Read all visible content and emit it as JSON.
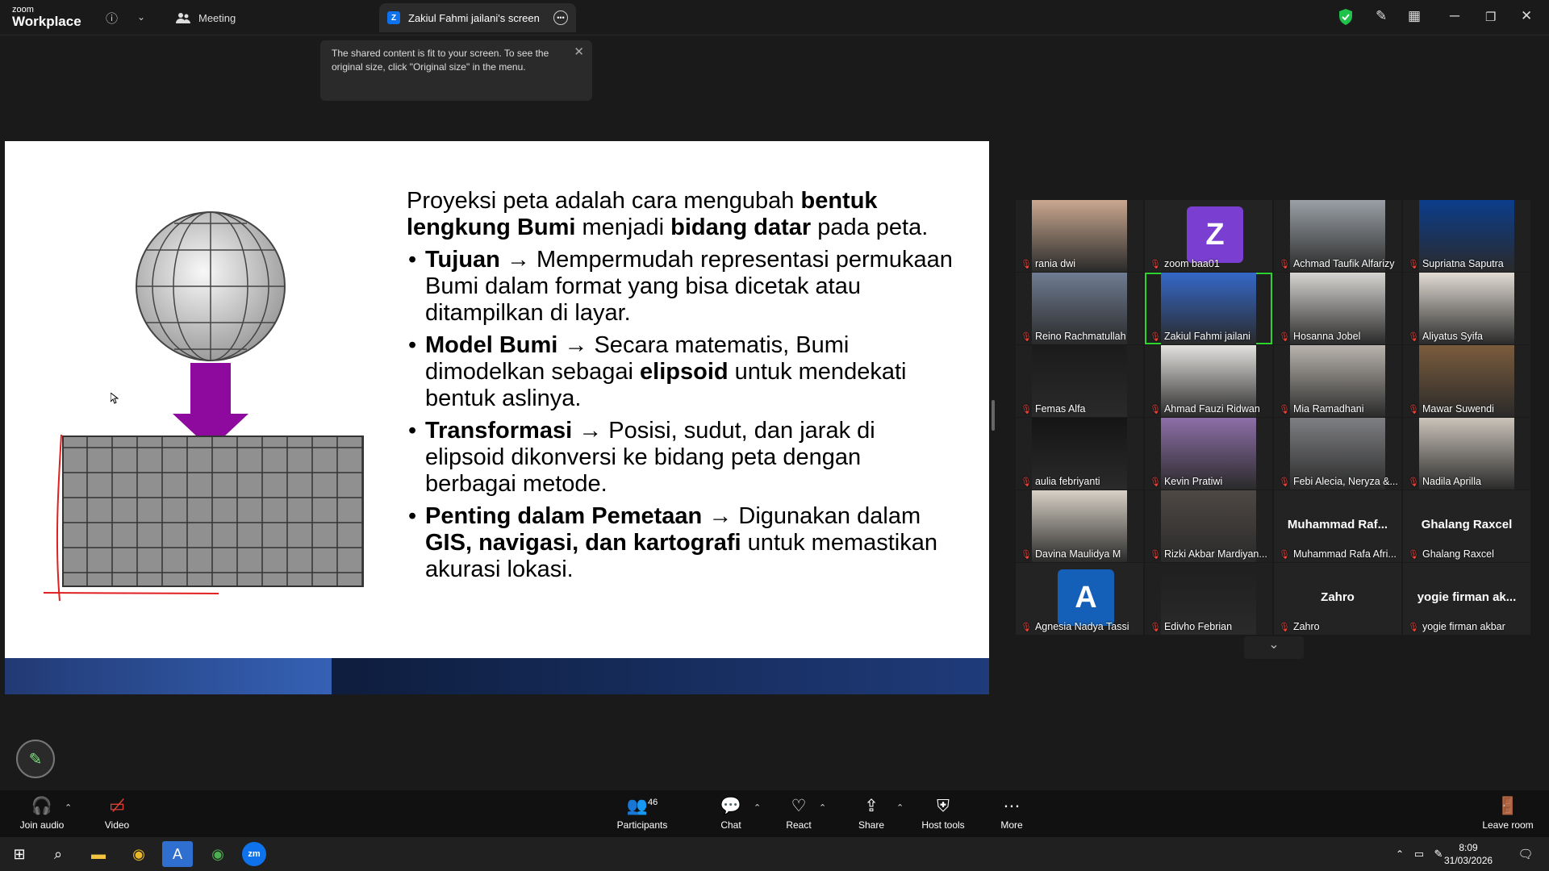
{
  "app": {
    "logo_small": "zoom",
    "logo_big": "Workplace",
    "meeting_label": "Meeting",
    "share_tab": "Zakiul Fahmi jailani's screen",
    "tab_icon_letter": "Z"
  },
  "tooltip": {
    "text": "The shared content is fit to your screen. To see the original size, click \"Original size\" in the menu."
  },
  "slide": {
    "intro": {
      "a": "Proyeksi peta adalah cara mengubah ",
      "b": "bentuk lengkung Bumi",
      "c": " menjadi ",
      "d": "bidang datar",
      "e": " pada peta."
    },
    "bullets": [
      {
        "head": "Tujuan",
        "arrow": " → ",
        "body": "Mempermudah representasi permukaan Bumi dalam format yang bisa dicetak atau ditampilkan di layar.",
        "bold2": "",
        "tail": ""
      },
      {
        "head": "Model Bumi",
        "arrow": " → ",
        "body": "Secara matematis, Bumi dimodelkan sebagai ",
        "bold2": "elipsoid",
        "tail": " untuk mendekati bentuk aslinya."
      },
      {
        "head": "Transformasi",
        "arrow": " → ",
        "body": "Posisi, sudut, dan jarak di elipsoid dikonversi ke bidang peta dengan berbagai metode.",
        "bold2": "",
        "tail": ""
      },
      {
        "head": "Penting dalam Pemetaan",
        "arrow": " → ",
        "body": "Digunakan dalam ",
        "bold2": "GIS, navigasi, dan kartografi",
        "tail": " untuk memastikan akurasi lokasi."
      }
    ]
  },
  "participants_grid": [
    {
      "name": "rania dwi",
      "type": "video",
      "bg": "#caa890"
    },
    {
      "name": "zoom baa01",
      "type": "avatar",
      "letter": "Z",
      "color": "#7a3fd0"
    },
    {
      "name": "Achmad Taufik Alfarizy",
      "type": "video",
      "bg": "#9aa0a6"
    },
    {
      "name": "Supriatna Saputra",
      "type": "video",
      "bg": "#0b3d8c"
    },
    {
      "name": "Reino Rachmatullah",
      "type": "video",
      "bg": "#6f7c92"
    },
    {
      "name": "Zakiul Fahmi jailani",
      "type": "video",
      "bg": "#3568c8",
      "active": true
    },
    {
      "name": "Hosanna Jobel",
      "type": "video",
      "bg": "#d7d5d2"
    },
    {
      "name": "Aliyatus Syifa",
      "type": "video",
      "bg": "#e2dcd4"
    },
    {
      "name": "Femas Alfa",
      "type": "video",
      "bg": "#1b1b1b"
    },
    {
      "name": "Ahmad Fauzi Ridwan",
      "type": "video",
      "bg": "#e4e2df"
    },
    {
      "name": "Mia Ramadhani",
      "type": "video",
      "bg": "#b9b4ad"
    },
    {
      "name": "Mawar Suwendi",
      "type": "video",
      "bg": "#7b5c3c"
    },
    {
      "name": "aulia febriyanti",
      "type": "video",
      "bg": "#151515"
    },
    {
      "name": "Kevin Pratiwi",
      "type": "video",
      "bg": "#8d6fa8"
    },
    {
      "name": "Febi Alecia, Neryza &...",
      "type": "video",
      "bg": "#7e7f82"
    },
    {
      "name": "Nadila Aprilla",
      "type": "video",
      "bg": "#cbc4ba"
    },
    {
      "name": "Davina Maulidya M",
      "type": "video",
      "bg": "#d8d1c6"
    },
    {
      "name": "Rizki Akbar Mardiyan...",
      "type": "video",
      "bg": "#4e4844"
    },
    {
      "name": "Muhammad Rafa Afri...",
      "type": "name",
      "big": "Muhammad  Raf..."
    },
    {
      "name": "Ghalang Raxcel",
      "type": "name",
      "big": "Ghalang Raxcel"
    },
    {
      "name": "Agnesia Nadya Tassi",
      "type": "avatar",
      "letter": "A",
      "color": "#1460b8"
    },
    {
      "name": "Edivho Febrian",
      "type": "video",
      "bg": "#1f1f1f"
    },
    {
      "name": "Zahro",
      "type": "name",
      "big": "Zahro"
    },
    {
      "name": "yogie firman akbar",
      "type": "name",
      "big": "yogie firman ak..."
    }
  ],
  "toolbar": {
    "join_audio": "Join audio",
    "video": "Video",
    "participants": "Participants",
    "participants_count": "46",
    "chat": "Chat",
    "react": "React",
    "share": "Share",
    "host_tools": "Host tools",
    "more": "More",
    "leave": "Leave room"
  },
  "clock": {
    "time": "8:09",
    "date": "31/03/2026"
  },
  "colors": {
    "accent_green": "#2ed42e",
    "brand_blue": "#0e72ed",
    "slide_arrow": "#8e0a9e",
    "muted_mic": "#e8443a"
  }
}
